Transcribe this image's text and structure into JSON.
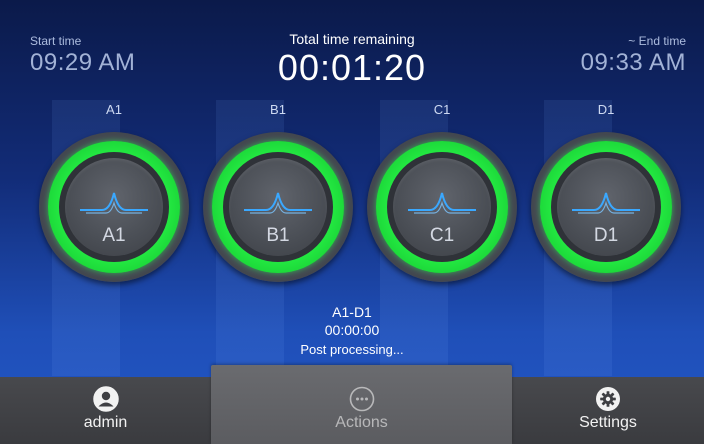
{
  "header": {
    "start_label": "Start time",
    "start_time": "09:29 AM",
    "total_label": "Total time remaining",
    "total_time": "00:01:20",
    "end_label": "~ End time",
    "end_time": "09:33 AM"
  },
  "wells": [
    {
      "top_label": "A1",
      "inner_label": "A1"
    },
    {
      "top_label": "B1",
      "inner_label": "B1"
    },
    {
      "top_label": "C1",
      "inner_label": "C1"
    },
    {
      "top_label": "D1",
      "inner_label": "D1"
    }
  ],
  "status": {
    "range": "A1-D1",
    "elapsed": "00:00:00",
    "message": "Post processing..."
  },
  "nav": {
    "admin_label": "admin",
    "actions_label": "Actions",
    "settings_label": "Settings"
  },
  "colors": {
    "ring_green": "#22e640",
    "peak_blue": "#3aa8ff",
    "bar_gray": "#3f4044"
  },
  "icons": {
    "admin": "user-circle-icon",
    "actions": "more-horizontal-icon",
    "settings": "gear-icon",
    "well": "peak-waveform-icon"
  }
}
